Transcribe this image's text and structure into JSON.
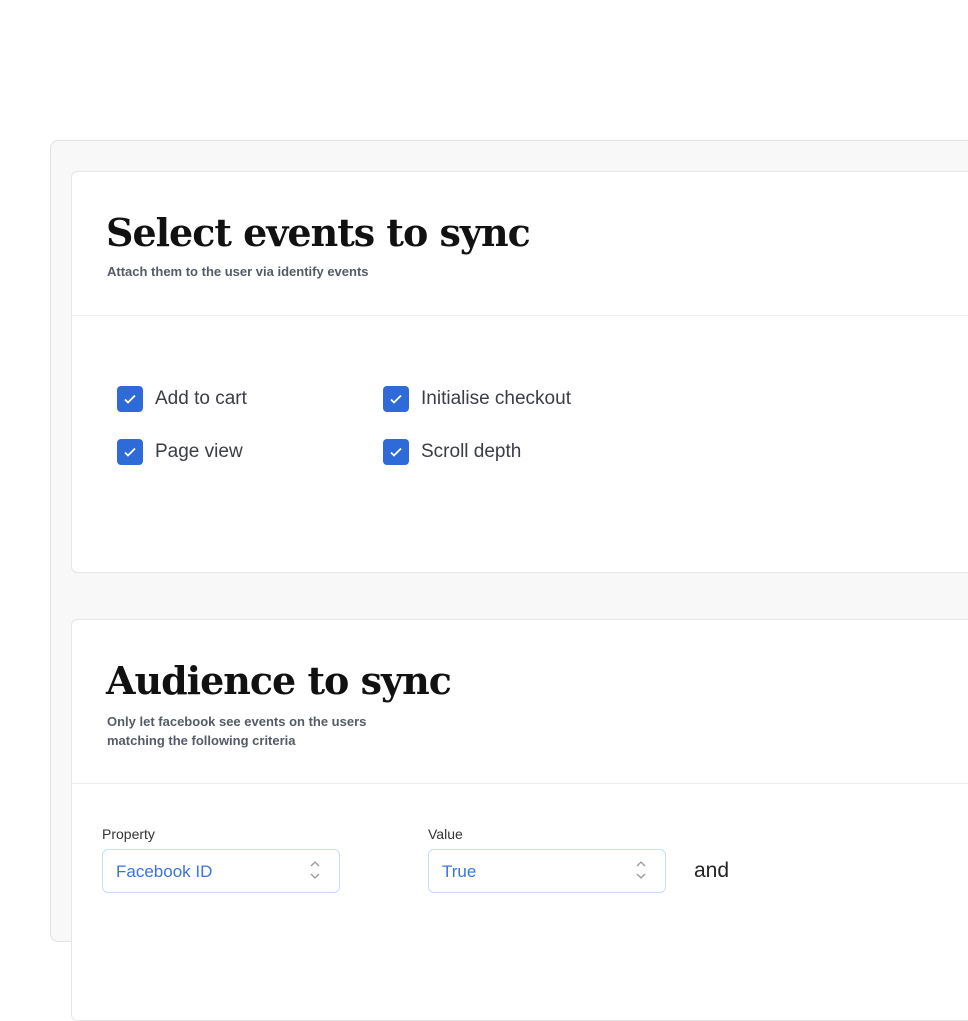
{
  "events_card": {
    "title": "Select events to sync",
    "subtitle": "Attach them to the user via identify events",
    "events": [
      {
        "label": "Add to cart",
        "checked": true
      },
      {
        "label": "Initialise checkout",
        "checked": true
      },
      {
        "label": "Page view",
        "checked": true
      },
      {
        "label": "Scroll depth",
        "checked": true
      }
    ]
  },
  "audience_card": {
    "title": "Audience to sync",
    "subtitle_line1": "Only let facebook see events on the users",
    "subtitle_line2": "matching the following criteria",
    "property_label": "Property",
    "property_value": "Facebook ID",
    "value_label": "Value",
    "value_value": "True",
    "conjunction": "and"
  },
  "colors": {
    "accent": "#2f6ad9",
    "select_text": "#3a74dc"
  }
}
